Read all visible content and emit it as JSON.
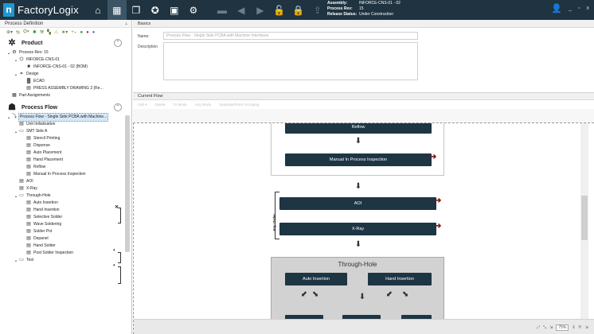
{
  "topbar": {
    "logo_mark": "n",
    "app_name": "FactoryLogix",
    "assembly_label": "Assembly:",
    "assembly_value": "INFORCE-CNS-01 - 02",
    "process_rev_label": "Process Rev:",
    "process_rev_value": "15",
    "release_status_label": "Release Status:",
    "release_status_value": "Under Construction",
    "min_label": "_",
    "restore_label": "▫",
    "close_label": "x"
  },
  "left": {
    "panel_title": "Process Definition",
    "pin_icon": "📌",
    "product_title": "Product",
    "process_flow_title": "Process Flow",
    "product_tree": [
      {
        "label": "Process Rev: 15",
        "level": 0,
        "icon": "⚙",
        "toggle": "▴"
      },
      {
        "label": "INFORCE-CNS-01",
        "level": 1,
        "icon": "⌬",
        "toggle": "▴"
      },
      {
        "label": "INFORCE-CNS-01 - 02 (BOM)",
        "level": 2,
        "icon": "■",
        "toggle": ""
      },
      {
        "label": "Design",
        "level": 1,
        "icon": "⌗",
        "toggle": "▴"
      },
      {
        "label": "ECAD",
        "level": 2,
        "icon": "▓",
        "toggle": ""
      },
      {
        "label": "PRESS ASSEMBLY DRAWING 2 (Re...",
        "level": 2,
        "icon": "▤",
        "toggle": ""
      },
      {
        "label": "Part Assignments",
        "level": 0,
        "icon": "▦",
        "toggle": ""
      }
    ],
    "flow_tree": [
      {
        "label": "Process Flow - Single Side PCBA with Machine...",
        "level": 0,
        "icon": "⤵",
        "toggle": "▴",
        "selected": true
      },
      {
        "label": "Unit Initialization",
        "level": 1,
        "icon": "▤",
        "toggle": ""
      },
      {
        "label": "SMT Side A",
        "level": 1,
        "icon": "▭",
        "toggle": "▴"
      },
      {
        "label": "Stencil Printing",
        "level": 2,
        "icon": "▤",
        "toggle": ""
      },
      {
        "label": "Dispense",
        "level": 2,
        "icon": "▤",
        "toggle": ""
      },
      {
        "label": "Auto Placement",
        "level": 2,
        "icon": "▤",
        "toggle": ""
      },
      {
        "label": "Hand Placement",
        "level": 2,
        "icon": "▤",
        "toggle": ""
      },
      {
        "label": "Reflow",
        "level": 2,
        "icon": "▤",
        "toggle": ""
      },
      {
        "label": "Manual In Process Inspection",
        "level": 2,
        "icon": "▤",
        "toggle": ""
      },
      {
        "label": "AOI",
        "level": 1,
        "icon": "▤",
        "toggle": ""
      },
      {
        "label": "X-Ray",
        "level": 1,
        "icon": "▤",
        "toggle": ""
      },
      {
        "label": "Through-Hole",
        "level": 1,
        "icon": "▭",
        "toggle": "▴"
      },
      {
        "label": "Auto Insertion",
        "level": 2,
        "icon": "▤",
        "toggle": ""
      },
      {
        "label": "Hand Insertion",
        "level": 2,
        "icon": "▤",
        "toggle": ""
      },
      {
        "label": "Selective Solder",
        "level": 2,
        "icon": "▤",
        "toggle": ""
      },
      {
        "label": "Wave Soldering",
        "level": 2,
        "icon": "▤",
        "toggle": ""
      },
      {
        "label": "Solder Pot",
        "level": 2,
        "icon": "▤",
        "toggle": ""
      },
      {
        "label": "Depanel",
        "level": 2,
        "icon": "▤",
        "toggle": ""
      },
      {
        "label": "Hand Solder",
        "level": 2,
        "icon": "▤",
        "toggle": ""
      },
      {
        "label": "Post Solder Inspection",
        "level": 2,
        "icon": "▤",
        "toggle": ""
      },
      {
        "label": "Test",
        "level": 1,
        "icon": "▭",
        "toggle": "▴"
      }
    ]
  },
  "basics": {
    "section_title": "Basics",
    "name_label": "Name:",
    "name_value": "Process Flow - Single Side PCBA with Machine Interfaces",
    "description_label": "Description"
  },
  "current_flow": {
    "section_title": "Current Flow",
    "tools": [
      "Add ▾",
      "Delete",
      "To Mode",
      "Any Mode",
      "Separate/Enter Grouping"
    ]
  },
  "flow": {
    "reflow": "Reflow",
    "manual_inspection": "Manual In Process Inspection",
    "aoi": "AOI",
    "xray": "X-Ray",
    "any_order": "Any Order",
    "through_hole": "Through-Hole",
    "auto_insertion": "Auto Insertion",
    "hand_insertion": "Hand Insertion"
  },
  "status": {
    "zoom": "75%"
  }
}
